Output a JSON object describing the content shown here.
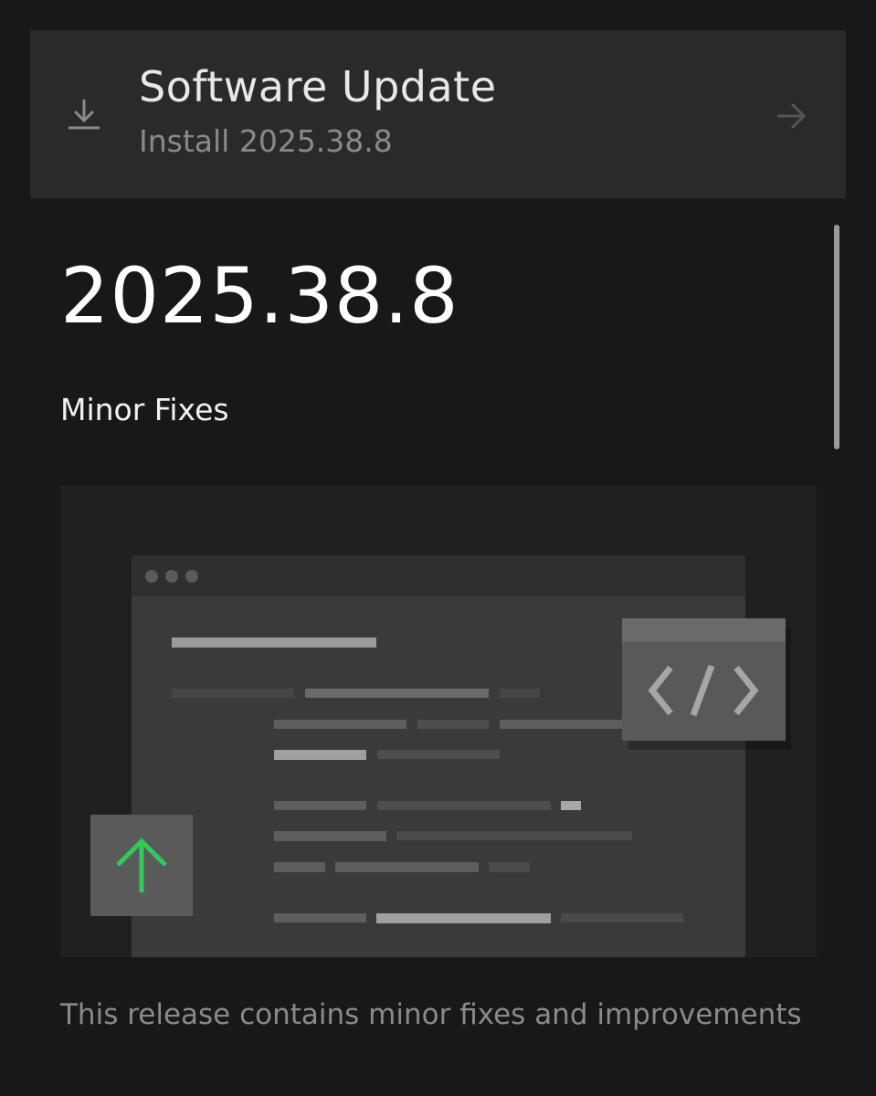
{
  "banner": {
    "title": "Software Update",
    "subtitle": "Install 2025.38.8",
    "leading_icon": "download-icon",
    "trailing_icon": "arrow-right-icon"
  },
  "release": {
    "version": "2025.38.8",
    "type": "Minor Fixes",
    "description": "This release contains minor fixes and improvements"
  },
  "illustration": {
    "icons": [
      "code-icon",
      "arrow-up-icon"
    ],
    "accent_color": "#2ecc5a"
  },
  "colors": {
    "background": "#18181a",
    "banner": "#2a2a2b",
    "accent_green": "#2ecc5a"
  }
}
